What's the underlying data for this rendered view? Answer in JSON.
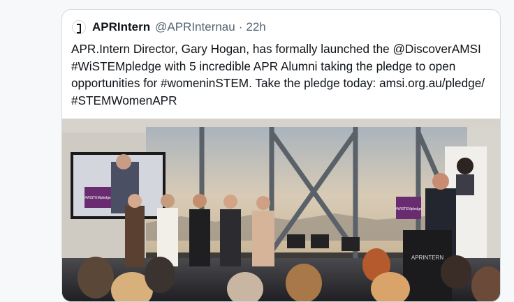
{
  "tweet": {
    "display_name": "APRIntern",
    "handle": "@APRInternau",
    "separator": "·",
    "timestamp": "22h",
    "text": "APR.Intern Director, Gary Hogan, has formally launched the @DiscoverAMSI #WiSTEMpledge with 5 incredible APR Alumni taking the pledge to open opportunities for #womeninSTEM. Take the pledge today: amsi.org.au/pledge/ #STEMWomenAPR"
  },
  "photo": {
    "screen_label": "#WiSTEMpledge",
    "podium_sign_label": "#WiSTEMpledge",
    "podium_logo": "APRINTERN"
  },
  "colors": {
    "text_primary": "#0f1419",
    "text_secondary": "#536471",
    "card_border": "#cfd9de",
    "sign_purple": "#6a2c70"
  }
}
